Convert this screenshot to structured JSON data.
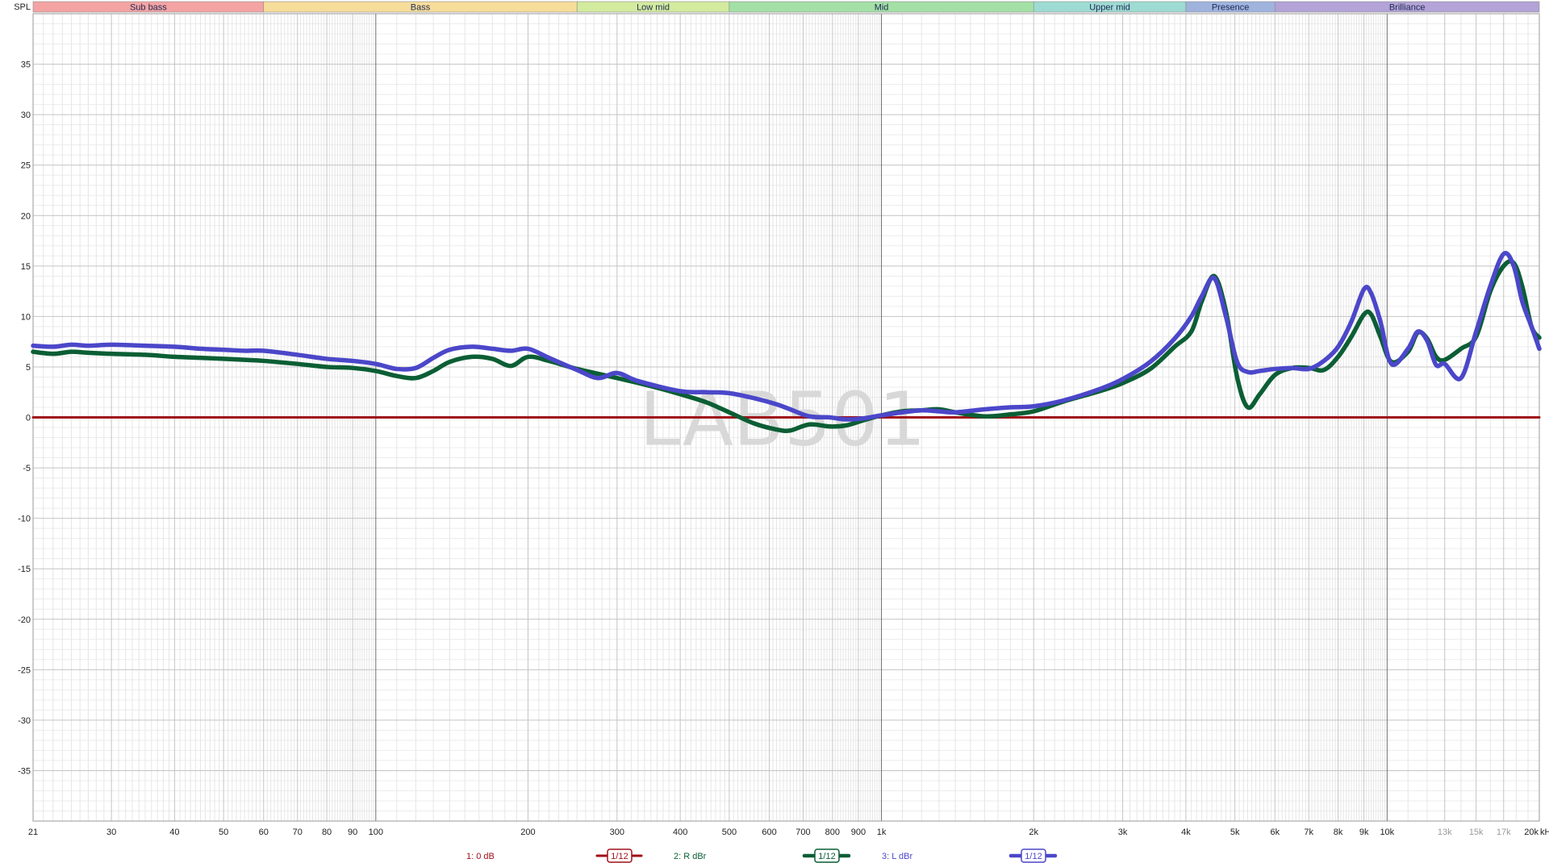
{
  "chart_data": {
    "type": "line",
    "watermark": "LAB501",
    "ylabel": "SPL",
    "xunit": "kHz",
    "xscale": "log",
    "xlim": [
      21,
      20000
    ],
    "ylim": [
      -40,
      40
    ],
    "grid": true,
    "x_ticks": [
      {
        "v": 21,
        "label": "21"
      },
      {
        "v": 30,
        "label": "30"
      },
      {
        "v": 40,
        "label": "40"
      },
      {
        "v": 50,
        "label": "50"
      },
      {
        "v": 60,
        "label": "60"
      },
      {
        "v": 70,
        "label": "70"
      },
      {
        "v": 80,
        "label": "80"
      },
      {
        "v": 90,
        "label": "90"
      },
      {
        "v": 100,
        "label": "100"
      },
      {
        "v": 200,
        "label": "200"
      },
      {
        "v": 300,
        "label": "300"
      },
      {
        "v": 400,
        "label": "400"
      },
      {
        "v": 500,
        "label": "500"
      },
      {
        "v": 600,
        "label": "600"
      },
      {
        "v": 700,
        "label": "700"
      },
      {
        "v": 800,
        "label": "800"
      },
      {
        "v": 900,
        "label": "900"
      },
      {
        "v": 1000,
        "label": "1k"
      },
      {
        "v": 2000,
        "label": "2k"
      },
      {
        "v": 3000,
        "label": "3k"
      },
      {
        "v": 4000,
        "label": "4k"
      },
      {
        "v": 5000,
        "label": "5k"
      },
      {
        "v": 6000,
        "label": "6k"
      },
      {
        "v": 7000,
        "label": "7k"
      },
      {
        "v": 8000,
        "label": "8k"
      },
      {
        "v": 9000,
        "label": "9k"
      },
      {
        "v": 10000,
        "label": "10k"
      },
      {
        "v": 13000,
        "label": "13k",
        "muted": true
      },
      {
        "v": 15000,
        "label": "15k",
        "muted": true
      },
      {
        "v": 17000,
        "label": "17k",
        "muted": true
      },
      {
        "v": 20000,
        "label": "20k"
      }
    ],
    "y_ticks": [
      35,
      30,
      25,
      20,
      15,
      10,
      5,
      0,
      -5,
      -10,
      -15,
      -20,
      -25,
      -30,
      -35
    ],
    "bands": [
      {
        "name": "Sub bass",
        "from": 21,
        "to": 60,
        "color": "#f4a3a3"
      },
      {
        "name": "Bass",
        "from": 60,
        "to": 250,
        "color": "#f7dd9a"
      },
      {
        "name": "Low mid",
        "from": 250,
        "to": 500,
        "color": "#d3eb9e"
      },
      {
        "name": "Mid",
        "from": 500,
        "to": 2000,
        "color": "#a3e0a6"
      },
      {
        "name": "Upper mid",
        "from": 2000,
        "to": 4000,
        "color": "#9edbd2"
      },
      {
        "name": "Presence",
        "from": 4000,
        "to": 6000,
        "color": "#9fb3dd"
      },
      {
        "name": "Brilliance",
        "from": 6000,
        "to": 20000,
        "color": "#b3a3d6"
      }
    ],
    "series": [
      {
        "name": "1: 0 dB",
        "color": "#a01018",
        "smoothing": "1/12",
        "points": [
          [
            21,
            0
          ],
          [
            20000,
            0
          ]
        ]
      },
      {
        "name": "2: R dBr",
        "color": "#0b5e34",
        "smoothing": "1/12",
        "points": [
          [
            21,
            6.5
          ],
          [
            23,
            6.3
          ],
          [
            25,
            6.5
          ],
          [
            27,
            6.4
          ],
          [
            30,
            6.3
          ],
          [
            35,
            6.2
          ],
          [
            40,
            6.0
          ],
          [
            45,
            5.9
          ],
          [
            50,
            5.8
          ],
          [
            55,
            5.7
          ],
          [
            60,
            5.6
          ],
          [
            70,
            5.3
          ],
          [
            80,
            5.0
          ],
          [
            90,
            4.9
          ],
          [
            100,
            4.6
          ],
          [
            110,
            4.1
          ],
          [
            120,
            3.9
          ],
          [
            130,
            4.6
          ],
          [
            140,
            5.5
          ],
          [
            155,
            6.0
          ],
          [
            170,
            5.8
          ],
          [
            185,
            5.1
          ],
          [
            200,
            6.0
          ],
          [
            220,
            5.6
          ],
          [
            250,
            4.8
          ],
          [
            300,
            3.9
          ],
          [
            350,
            3.1
          ],
          [
            400,
            2.3
          ],
          [
            450,
            1.5
          ],
          [
            500,
            0.5
          ],
          [
            560,
            -0.6
          ],
          [
            620,
            -1.2
          ],
          [
            660,
            -1.3
          ],
          [
            720,
            -0.7
          ],
          [
            790,
            -0.9
          ],
          [
            850,
            -0.8
          ],
          [
            920,
            -0.3
          ],
          [
            1000,
            0.2
          ],
          [
            1100,
            0.6
          ],
          [
            1200,
            0.7
          ],
          [
            1300,
            0.8
          ],
          [
            1400,
            0.5
          ],
          [
            1600,
            0.1
          ],
          [
            1800,
            0.3
          ],
          [
            2000,
            0.6
          ],
          [
            2300,
            1.6
          ],
          [
            2700,
            2.6
          ],
          [
            3000,
            3.4
          ],
          [
            3400,
            4.8
          ],
          [
            3800,
            7.0
          ],
          [
            4100,
            8.5
          ],
          [
            4300,
            11.5
          ],
          [
            4550,
            14.0
          ],
          [
            4800,
            10.5
          ],
          [
            5050,
            4.0
          ],
          [
            5300,
            1.0
          ],
          [
            5600,
            2.3
          ],
          [
            6000,
            4.2
          ],
          [
            6500,
            4.9
          ],
          [
            7000,
            4.9
          ],
          [
            7500,
            4.7
          ],
          [
            8000,
            6.0
          ],
          [
            8500,
            8.0
          ],
          [
            9000,
            10.2
          ],
          [
            9300,
            10.2
          ],
          [
            9700,
            8.0
          ],
          [
            10200,
            5.5
          ],
          [
            11000,
            6.5
          ],
          [
            11500,
            8.4
          ],
          [
            12000,
            7.8
          ],
          [
            12500,
            6.0
          ],
          [
            13000,
            5.7
          ],
          [
            14000,
            6.8
          ],
          [
            15000,
            8.0
          ],
          [
            16000,
            12.5
          ],
          [
            17000,
            15.0
          ],
          [
            17800,
            15.3
          ],
          [
            18500,
            13.0
          ],
          [
            19300,
            9.0
          ],
          [
            20000,
            7.9
          ]
        ]
      },
      {
        "name": "3: L dBr",
        "color": "#4b47c9",
        "smoothing": "1/12",
        "points": [
          [
            21,
            7.1
          ],
          [
            23,
            7.0
          ],
          [
            25,
            7.2
          ],
          [
            27,
            7.1
          ],
          [
            30,
            7.2
          ],
          [
            35,
            7.1
          ],
          [
            40,
            7.0
          ],
          [
            45,
            6.8
          ],
          [
            50,
            6.7
          ],
          [
            55,
            6.6
          ],
          [
            60,
            6.6
          ],
          [
            70,
            6.2
          ],
          [
            80,
            5.8
          ],
          [
            90,
            5.6
          ],
          [
            100,
            5.3
          ],
          [
            110,
            4.8
          ],
          [
            120,
            4.9
          ],
          [
            130,
            5.9
          ],
          [
            140,
            6.7
          ],
          [
            155,
            7.0
          ],
          [
            170,
            6.8
          ],
          [
            185,
            6.6
          ],
          [
            200,
            6.8
          ],
          [
            220,
            5.9
          ],
          [
            250,
            4.7
          ],
          [
            275,
            3.9
          ],
          [
            300,
            4.4
          ],
          [
            330,
            3.6
          ],
          [
            400,
            2.6
          ],
          [
            450,
            2.5
          ],
          [
            500,
            2.4
          ],
          [
            560,
            1.9
          ],
          [
            620,
            1.3
          ],
          [
            660,
            0.8
          ],
          [
            720,
            0.1
          ],
          [
            790,
            0.0
          ],
          [
            850,
            -0.2
          ],
          [
            920,
            -0.1
          ],
          [
            1000,
            0.2
          ],
          [
            1100,
            0.5
          ],
          [
            1200,
            0.7
          ],
          [
            1300,
            0.6
          ],
          [
            1400,
            0.5
          ],
          [
            1600,
            0.8
          ],
          [
            1800,
            1.0
          ],
          [
            2000,
            1.1
          ],
          [
            2300,
            1.7
          ],
          [
            2700,
            2.8
          ],
          [
            3000,
            3.8
          ],
          [
            3400,
            5.5
          ],
          [
            3800,
            7.8
          ],
          [
            4100,
            10.0
          ],
          [
            4300,
            12.0
          ],
          [
            4550,
            13.8
          ],
          [
            4800,
            10.0
          ],
          [
            5050,
            5.5
          ],
          [
            5300,
            4.5
          ],
          [
            5600,
            4.6
          ],
          [
            6000,
            4.8
          ],
          [
            6500,
            4.9
          ],
          [
            7000,
            4.8
          ],
          [
            7500,
            5.6
          ],
          [
            8000,
            7.0
          ],
          [
            8500,
            9.5
          ],
          [
            9000,
            12.7
          ],
          [
            9300,
            12.3
          ],
          [
            9700,
            9.5
          ],
          [
            10200,
            5.3
          ],
          [
            11000,
            6.8
          ],
          [
            11500,
            8.5
          ],
          [
            12000,
            7.6
          ],
          [
            12500,
            5.2
          ],
          [
            13000,
            5.3
          ],
          [
            14000,
            3.9
          ],
          [
            15000,
            8.5
          ],
          [
            16000,
            13.0
          ],
          [
            17000,
            16.2
          ],
          [
            17800,
            15.0
          ],
          [
            18500,
            11.5
          ],
          [
            19300,
            9.0
          ],
          [
            20000,
            6.8
          ]
        ]
      }
    ]
  }
}
